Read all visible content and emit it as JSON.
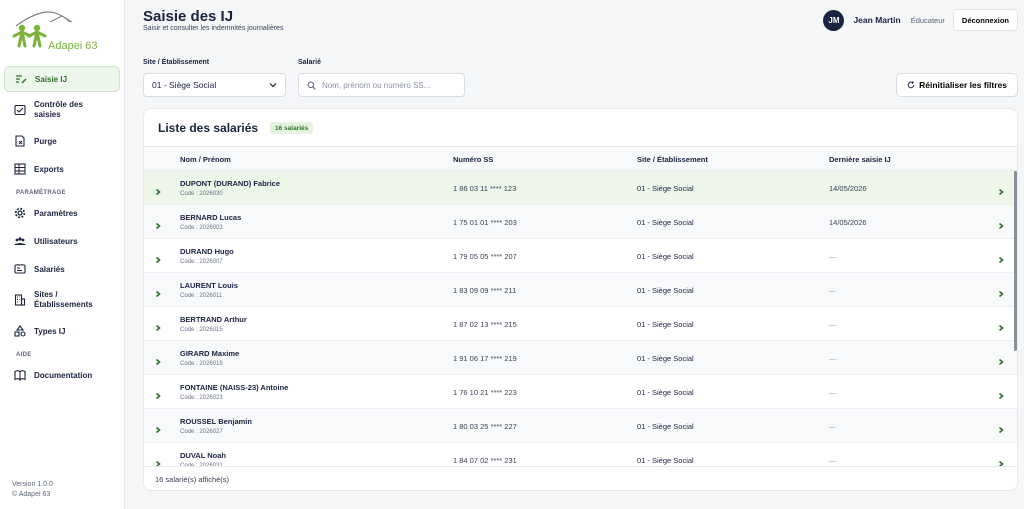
{
  "brand": {
    "name": "Adapei 63",
    "accent": "#7bb23a"
  },
  "sidebar": {
    "items": [
      {
        "label": "Saisie IJ",
        "icon": "edit-list-icon",
        "active": true
      },
      {
        "label": "Contrôle des saisies",
        "icon": "check-board-icon"
      },
      {
        "label": "Purge",
        "icon": "purge-icon"
      },
      {
        "label": "Exports",
        "icon": "table-export-icon"
      }
    ],
    "section_settings": "PARAMÉTRAGE",
    "settings_items": [
      {
        "label": "Paramètres",
        "icon": "gear-icon"
      },
      {
        "label": "Utilisateurs",
        "icon": "users-icon"
      },
      {
        "label": "Salariés",
        "icon": "id-card-icon"
      },
      {
        "label": "Sites / Établissements",
        "icon": "building-icon"
      },
      {
        "label": "Types IJ",
        "icon": "types-icon"
      }
    ],
    "section_help": "AIDE",
    "help_items": [
      {
        "label": "Documentation",
        "icon": "book-icon"
      }
    ],
    "version": "Version 1.0.0",
    "copyright": "© Adapei 63"
  },
  "header": {
    "title": "Saisie des IJ",
    "subtitle": "Saisir et consulter les indemnités journalières",
    "user_initials": "JM",
    "user_name": "Jean Martin",
    "user_role": "Éducateur",
    "logout_label": "Déconnexion"
  },
  "filters": {
    "site_label": "Site / Établissement",
    "site_value": "01 - Siège Social",
    "employee_label": "Salarié",
    "search_placeholder": "Nom, prénom ou numéro SS...",
    "reset_label": "Réinitialiser les filtres"
  },
  "list": {
    "title": "Liste des salariés",
    "badge": "16 salariés",
    "columns": [
      "Nom / Prénom",
      "Numéro SS",
      "Site / Établissement",
      "Dernière saisie IJ"
    ],
    "rows": [
      {
        "name": "DUPONT (DURAND) Fabrice",
        "code": "Code : 2026030",
        "ss": "1 86 03 11 **** 123",
        "site": "01 - Siège Social",
        "date": "14/05/2026",
        "highlight": true
      },
      {
        "name": "BERNARD Lucas",
        "code": "Code : 2026003",
        "ss": "1 75 01 01 **** 203",
        "site": "01 - Siège Social",
        "date": "14/05/2026"
      },
      {
        "name": "DURAND Hugo",
        "code": "Code : 2026007",
        "ss": "1 79 05 05 **** 207",
        "site": "01 - Siège Social",
        "date": "—"
      },
      {
        "name": "LAURENT Louis",
        "code": "Code : 2026011",
        "ss": "1 83 09 09 **** 211",
        "site": "01 - Siège Social",
        "date": "—"
      },
      {
        "name": "BERTRAND Arthur",
        "code": "Code : 2026015",
        "ss": "1 87 02 13 **** 215",
        "site": "01 - Siège Social",
        "date": "—"
      },
      {
        "name": "GIRARD Maxime",
        "code": "Code : 2026019",
        "ss": "1 91 06 17 **** 219",
        "site": "01 - Siège Social",
        "date": "—"
      },
      {
        "name": "FONTAINE (NAISS-23) Antoine",
        "code": "Code : 2026023",
        "ss": "1 76 10 21 **** 223",
        "site": "01 - Siège Social",
        "date": "—"
      },
      {
        "name": "ROUSSEL Benjamin",
        "code": "Code : 2026027",
        "ss": "1 80 03 25 **** 227",
        "site": "01 - Siège Social",
        "date": "—"
      },
      {
        "name": "DUVAL Noah",
        "code": "Code : 2026031",
        "ss": "1 84 07 02 **** 231",
        "site": "01 - Siège Social",
        "date": "—"
      }
    ],
    "footer": "16 salarié(s) affiché(s)"
  }
}
